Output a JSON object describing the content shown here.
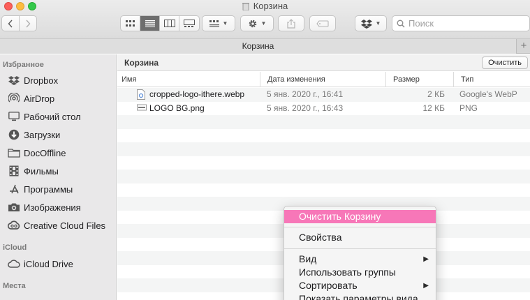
{
  "window": {
    "title": "Корзина"
  },
  "toolbar": {
    "search_placeholder": "Поиск",
    "view_modes": [
      "icons",
      "list",
      "columns",
      "gallery"
    ],
    "active_view": "list"
  },
  "tabbar": {
    "tab_label": "Корзина",
    "add_tab": "+"
  },
  "sidebar": {
    "sections": [
      {
        "title": "Избранное",
        "items": [
          {
            "label": "Dropbox",
            "icon": "dropbox-icon"
          },
          {
            "label": "AirDrop",
            "icon": "airdrop-icon"
          },
          {
            "label": "Рабочий стол",
            "icon": "desktop-icon"
          },
          {
            "label": "Загрузки",
            "icon": "downloads-icon"
          },
          {
            "label": "DocOffline",
            "icon": "folder-icon"
          },
          {
            "label": "Фильмы",
            "icon": "movies-icon"
          },
          {
            "label": "Программы",
            "icon": "applications-icon"
          },
          {
            "label": "Изображения",
            "icon": "camera-icon"
          },
          {
            "label": "Creative Cloud Files",
            "icon": "creative-cloud-icon"
          }
        ]
      },
      {
        "title": "iCloud",
        "items": [
          {
            "label": "iCloud Drive",
            "icon": "cloud-icon"
          }
        ]
      },
      {
        "title": "Места",
        "items": []
      }
    ]
  },
  "main": {
    "path_title": "Корзина",
    "empty_button": "Очистить",
    "columns": [
      "Имя",
      "Дата изменения",
      "Размер",
      "Тип"
    ],
    "files": [
      {
        "name": "cropped-logo-ithere.webp",
        "date": "5 янв. 2020 г., 16:41",
        "size": "2 КБ",
        "type": "Google's WebP"
      },
      {
        "name": "LOGO BG.png",
        "date": "5 янв. 2020 г., 16:43",
        "size": "12 КБ",
        "type": "PNG"
      }
    ]
  },
  "context_menu": {
    "items": [
      {
        "label": "Очистить Корзину",
        "highlighted": true
      },
      {
        "label": "Свойства"
      },
      {
        "label": "Вид",
        "submenu": true
      },
      {
        "label": "Использовать группы"
      },
      {
        "label": "Сортировать",
        "submenu": true
      },
      {
        "label": "Показать параметры вида"
      }
    ]
  },
  "colors": {
    "menu_highlight": "#f777b8",
    "close": "#fc605b",
    "minimize": "#fdbc40",
    "maximize": "#34c84a"
  }
}
